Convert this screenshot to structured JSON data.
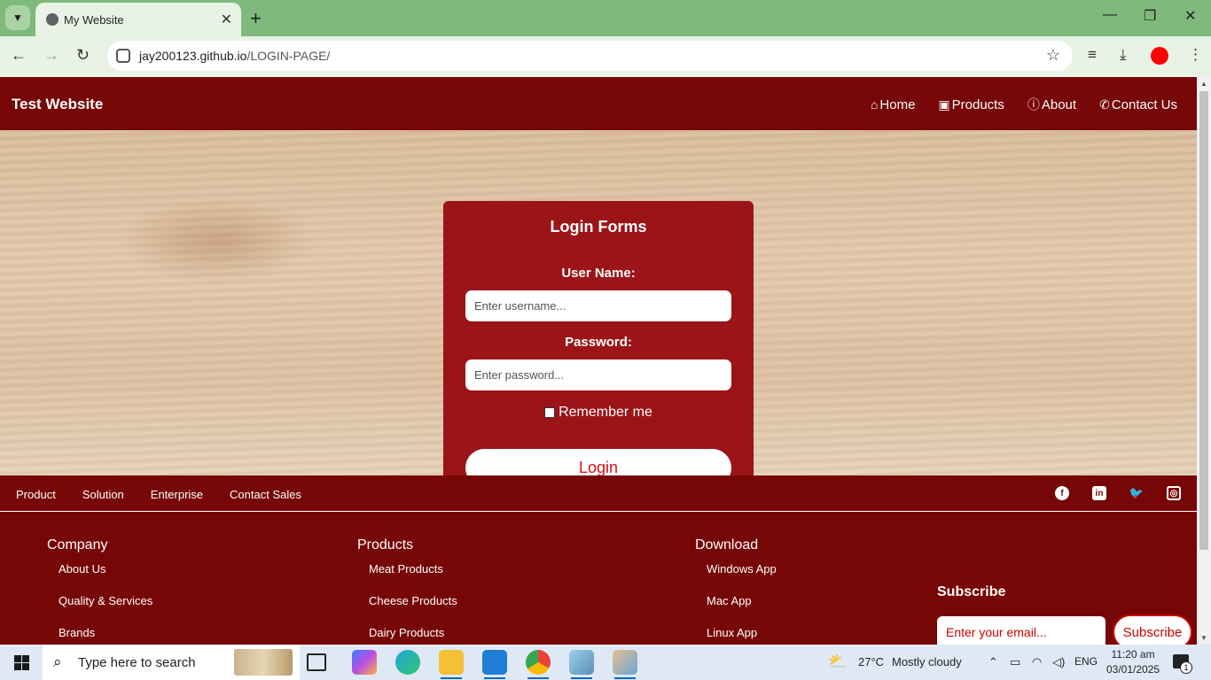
{
  "browser": {
    "tab_title": "My Website",
    "url_host": "jay200123.github.io",
    "url_path": "/LOGIN-PAGE/"
  },
  "site": {
    "brand": "Test Website",
    "nav": [
      {
        "icon": "home-icon",
        "label": "Home"
      },
      {
        "icon": "box-icon",
        "label": "Products"
      },
      {
        "icon": "info-icon",
        "label": "About"
      },
      {
        "icon": "phone-icon",
        "label": "Contact Us"
      }
    ]
  },
  "login": {
    "title": "Login Forms",
    "username_label": "User Name:",
    "username_placeholder": "Enter username...",
    "password_label": "Password:",
    "password_placeholder": "Enter password...",
    "remember_label": "Remember me",
    "remember_checked": false,
    "button_label": "Login"
  },
  "footer": {
    "top_links": [
      "Product",
      "Solution",
      "Enterprise",
      "Contact Sales"
    ],
    "social": [
      "facebook-icon",
      "linkedin-icon",
      "twitter-icon",
      "instagram-icon"
    ],
    "columns": [
      {
        "title": "Company",
        "items": [
          "About Us",
          "Quality & Services",
          "Brands"
        ]
      },
      {
        "title": "Products",
        "items": [
          "Meat Products",
          "Cheese Products",
          "Dairy Products"
        ]
      },
      {
        "title": "Download",
        "items": [
          "Windows App",
          "Mac App",
          "Linux App"
        ]
      }
    ],
    "subscribe_title": "Subscribe",
    "subscribe_placeholder": "Enter your email...",
    "subscribe_button": "Subscribe"
  },
  "taskbar": {
    "search_placeholder": "Type here to search",
    "weather_temp": "27°C",
    "weather_desc": "Mostly cloudy",
    "language": "ENG",
    "time": "11:20 am",
    "date": "03/01/2025",
    "notification_count": "1"
  }
}
